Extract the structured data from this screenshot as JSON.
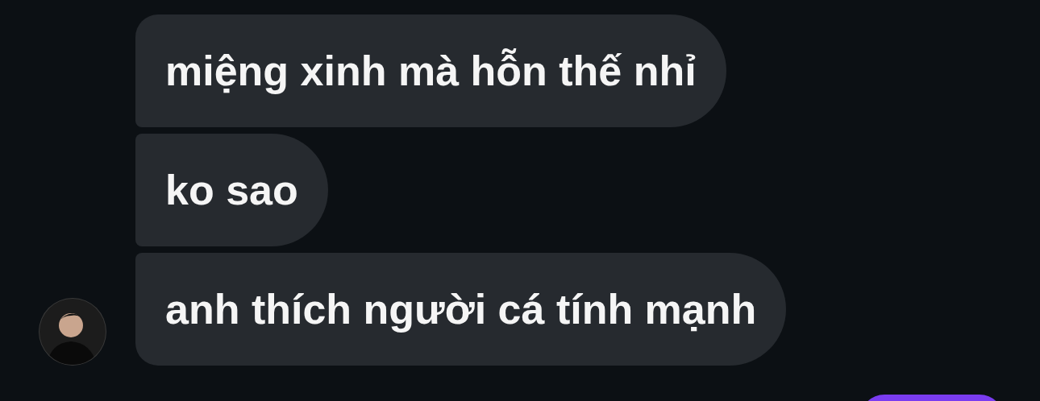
{
  "messages": [
    {
      "kind": "received",
      "text": "miệng xinh mà hỗn thế nhỉ"
    },
    {
      "kind": "received",
      "text": "ko sao"
    },
    {
      "kind": "received",
      "text": "anh thích người cá tính mạnh"
    },
    {
      "kind": "sent"
    }
  ]
}
